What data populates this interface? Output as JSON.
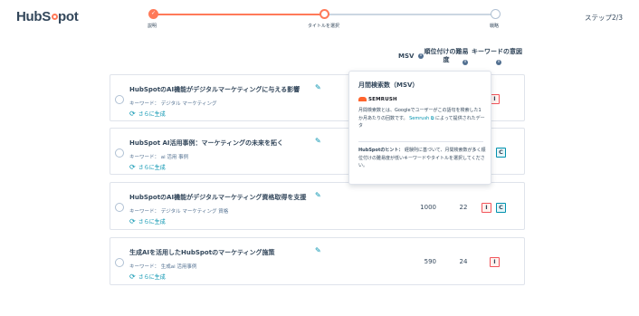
{
  "header": {
    "logo_text_a": "Hub",
    "logo_text_b": "pot",
    "step_count": "ステップ2/3"
  },
  "stepper": {
    "steps": [
      {
        "label": "説明",
        "state": "done"
      },
      {
        "label": "タイトルを選択",
        "state": "current"
      },
      {
        "label": "戦略",
        "state": "todo"
      }
    ],
    "check_glyph": "✓"
  },
  "columns": {
    "msv": "MSV",
    "difficulty": "順位付けの難易度",
    "intent": "キーワードの意図",
    "info_glyph": "i"
  },
  "cards": [
    {
      "title": "HubSpotのAI機能がデジタルマーケティングに与える影響",
      "keyword": "キーワード：  デジタル マーケティング",
      "regen": "さらに生成",
      "msv": "",
      "difficulty": "",
      "tags": [
        "I"
      ]
    },
    {
      "title": "HubSpot AI活用事例：マーケティングの未来を拓く",
      "keyword": "キーワード：  ai 活用 事例",
      "regen": "さらに生成",
      "msv": "",
      "difficulty": "",
      "tags": [
        "C"
      ]
    },
    {
      "title": "HubSpotのAI機能がデジタルマーケティング資格取得を支援",
      "keyword": "キーワード：  デジタル マーケティング 資格",
      "regen": "さらに生成",
      "msv": "1000",
      "difficulty": "22",
      "tags": [
        "I",
        "C"
      ]
    },
    {
      "title": "生成AIを活用したHubSpotのマーケティング施策",
      "keyword": "キーワード：  生成ai 活用事例",
      "regen": "さらに生成",
      "msv": "590",
      "difficulty": "24",
      "tags": [
        "I"
      ]
    }
  ],
  "popover": {
    "title": "月間検索数（MSV）",
    "brand": "SEMRUSH",
    "body_before_link": "月間検索数とは、Googleでユーザーがこの語句を検索した1か月あたりの回数です。",
    "link": "Semrush",
    "body_after_link": "によって提供されたデータ",
    "hint_label": "HubSpotのヒント：",
    "hint_text": "経験則に基づいて、月間検索数が多く順位付けの難易度が低いキーワードやタイトルを選択してください。"
  },
  "icons": {
    "edit": "edit-pencil-icon",
    "regen": "refresh-icon",
    "external": "external-link-icon"
  },
  "colors": {
    "accent": "#ff7a59",
    "link": "#0091ae",
    "text": "#33475b",
    "border": "#dfe3eb",
    "semrush": "#ff642d"
  }
}
